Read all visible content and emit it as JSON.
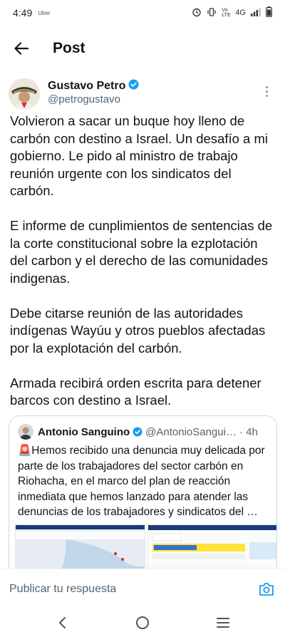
{
  "status": {
    "time": "4:49",
    "app": "Uber",
    "network": "4G",
    "volte": "Vo LTE",
    "icons": [
      "alarm-icon",
      "vibrate-icon",
      "signal-icon",
      "battery-icon"
    ]
  },
  "header": {
    "title": "Post",
    "back_icon": "back-arrow-icon"
  },
  "post": {
    "author_name": "Gustavo Petro",
    "author_handle": "@petrogustavo",
    "verified": true,
    "paragraphs": [
      "Volvieron a sacar un buque hoy lleno de carbón con destino a Israel. Un desafío a mi gobierno. Le pido al ministro de trabajo reunión urgente con los sindicatos del carbón.",
      "E informe de cunplimientos de sentencias de la corte constitucional sobre la ezplotación del carbon y el derecho de las comunidades indigenas.",
      "Debe citarse reunión de las autoridades indígenas Wayúu y otros pueblos afectadas por la explotación del carbón.",
      "Armada recibirá orden escrita para detener barcos con destino a Israel."
    ]
  },
  "quote": {
    "author_name": "Antonio Sanguino",
    "author_handle": "@AntonioSangui…",
    "time": "· 4h",
    "text": "🚨Hemos recibido una denuncia muy delicada por parte de los trabajadores del sector carbón en Riohacha, en el marco del plan de reacción inmediata que hemos lanzado para atender las denuncias de los trabajadores y sindicatos del …"
  },
  "reply": {
    "placeholder": "Publicar tu respuesta"
  },
  "colors": {
    "verified": "#1d9bf0",
    "text": "#0f1419",
    "muted": "#536471",
    "camera": "#1d9bf0"
  }
}
